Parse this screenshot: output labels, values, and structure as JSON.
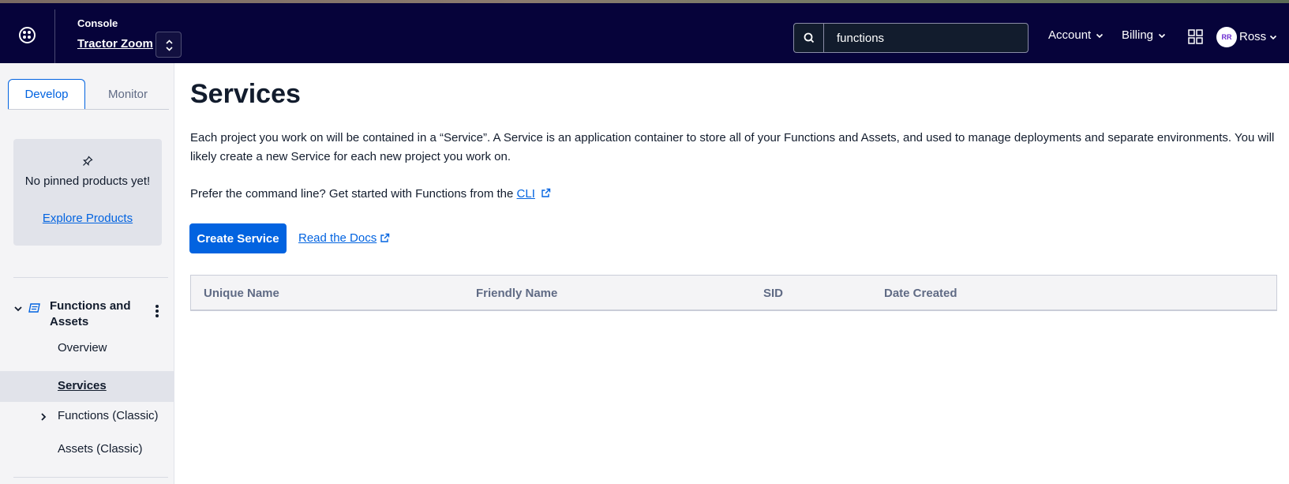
{
  "header": {
    "console_label": "Console",
    "project_name": "Tractor Zoom",
    "search_value": "functions",
    "account_label": "Account",
    "billing_label": "Billing",
    "user_initials": "RR",
    "user_name": "Ross"
  },
  "sidebar": {
    "tabs": [
      {
        "label": "Develop"
      },
      {
        "label": "Monitor"
      }
    ],
    "pinned": {
      "message": "No pinned products yet!",
      "explore_label": "Explore Products"
    },
    "section": {
      "title": "Functions and Assets",
      "items": [
        {
          "label": "Overview"
        },
        {
          "label": "Services"
        },
        {
          "label": "Functions (Classic)"
        },
        {
          "label": "Assets (Classic)"
        }
      ]
    }
  },
  "main": {
    "title": "Services",
    "description": "Each project you work on will be contained in a “Service”. A Service is an application container to store all of your Functions and Assets, and used to manage deployments and separate environments. You will likely create a new Service for each new project you work on.",
    "cli_prompt": "Prefer the command line? Get started with Functions from the ",
    "cli_link": "CLI",
    "create_button": "Create Service",
    "docs_link": "Read the Docs",
    "table": {
      "columns": [
        "Unique Name",
        "Friendly Name",
        "SID",
        "Date Created"
      ]
    }
  },
  "colors": {
    "topbar": "#06033a",
    "accent": "#0263e0",
    "avatar_text": "#6d2ed1"
  }
}
